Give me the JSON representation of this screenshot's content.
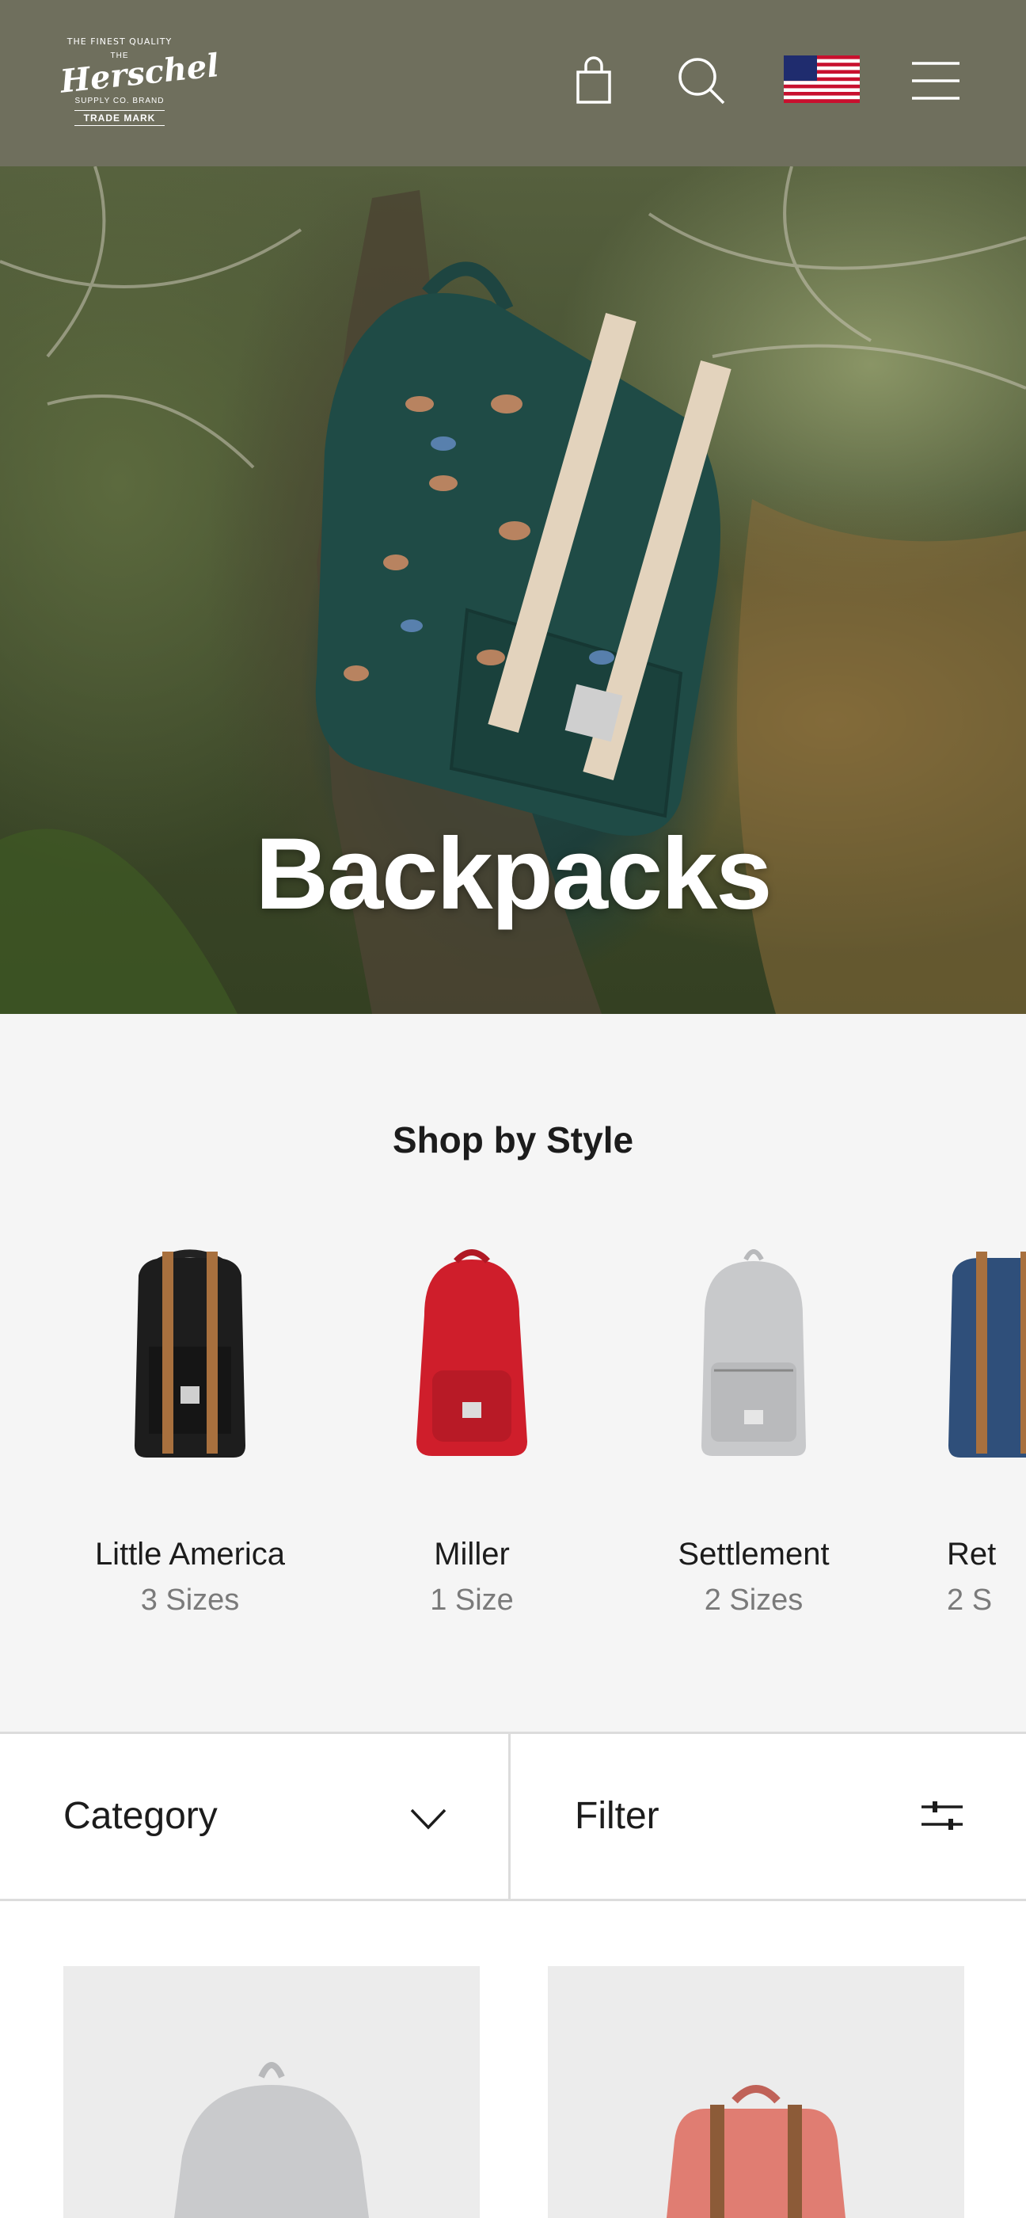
{
  "header": {
    "logo": {
      "top_text": "THE FINEST QUALITY",
      "the": "THE",
      "brand": "Herschel",
      "supply": "SUPPLY CO. BRAND",
      "trademark": "TRADE MARK"
    },
    "icons": [
      "shopping-bag-icon",
      "search-icon",
      "us-flag-icon",
      "hamburger-menu-icon"
    ],
    "bg_color": "#6f6f5d"
  },
  "hero": {
    "title": "Backpacks"
  },
  "shop_by_style": {
    "heading": "Shop by Style",
    "items": [
      {
        "name": "Little America",
        "sizes": "3 Sizes",
        "color": "#1d1d1d"
      },
      {
        "name": "Miller",
        "sizes": "1 Size",
        "color": "#cf1e2b"
      },
      {
        "name": "Settlement",
        "sizes": "2 Sizes",
        "color": "#c8c9cb"
      },
      {
        "name": "Ret",
        "sizes": "2 S",
        "color": "#2f4f7a"
      }
    ]
  },
  "filters": {
    "category_label": "Category",
    "filter_label": "Filter"
  },
  "products": [
    {
      "color": "#c9cacc"
    },
    {
      "color": "#e07d72"
    }
  ]
}
